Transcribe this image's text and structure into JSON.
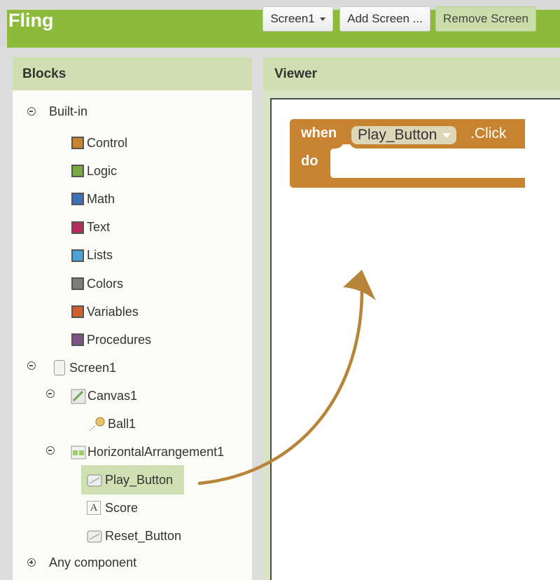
{
  "app": {
    "title": "Fling"
  },
  "toolbar": {
    "screen_select": "Screen1",
    "add_screen": "Add Screen ...",
    "remove_screen": "Remove Screen"
  },
  "blocks_panel": {
    "title": "Blocks",
    "builtin_label": "Built-in",
    "builtin": [
      {
        "label": "Control",
        "color": "#c88330"
      },
      {
        "label": "Logic",
        "color": "#77ab41"
      },
      {
        "label": "Math",
        "color": "#3f71b5"
      },
      {
        "label": "Text",
        "color": "#b32d5e"
      },
      {
        "label": "Lists",
        "color": "#49a6d4"
      },
      {
        "label": "Colors",
        "color": "#7d7d7d"
      },
      {
        "label": "Variables",
        "color": "#d05f2d"
      },
      {
        "label": "Procedures",
        "color": "#7c5385"
      }
    ],
    "screen": "Screen1",
    "canvas": "Canvas1",
    "ball": "Ball1",
    "arrangement": "HorizontalArrangement1",
    "play_button": "Play_Button",
    "score": "Score",
    "reset_button": "Reset_Button",
    "any_component": "Any component"
  },
  "viewer": {
    "title": "Viewer",
    "block": {
      "when": "when",
      "component": "Play_Button",
      "event": ".Click",
      "do": "do",
      "color": "#c88330"
    }
  }
}
